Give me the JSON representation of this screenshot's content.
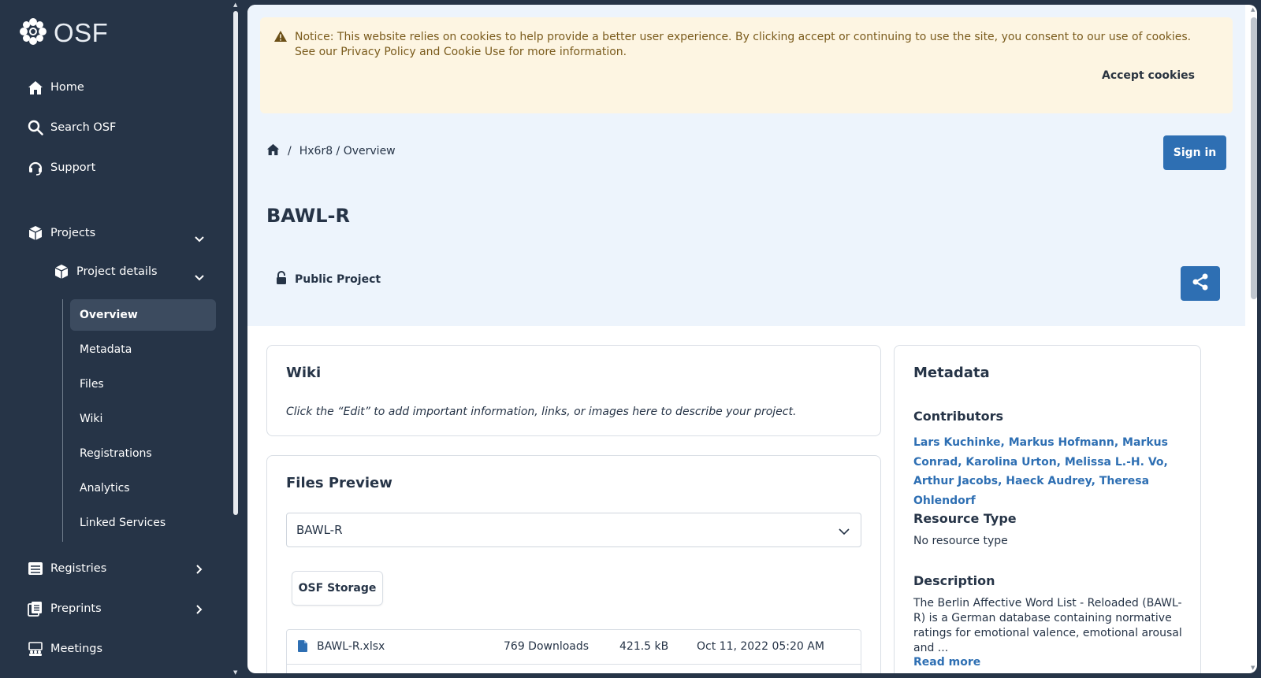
{
  "brand": {
    "name": "OSF"
  },
  "nav": {
    "home": "Home",
    "search": "Search OSF",
    "support": "Support",
    "projects": "Projects",
    "project_details": "Project details",
    "sub_items": [
      "Overview",
      "Metadata",
      "Files",
      "Wiki",
      "Registrations",
      "Analytics",
      "Linked Services"
    ],
    "registries": "Registries",
    "preprints": "Preprints",
    "meetings": "Meetings"
  },
  "cookie": {
    "message": "Notice: This website relies on cookies to help provide a better user experience. By clicking accept or continuing to use the site, you consent to our use of cookies. See our Privacy Policy and Cookie Use for more information.",
    "accept": "Accept cookies"
  },
  "breadcrumb": {
    "separator": "/",
    "path": "Hx6r8 / Overview"
  },
  "header": {
    "sign_in": "Sign in",
    "title": "BAWL-R",
    "visibility": "Public Project"
  },
  "wiki": {
    "title": "Wiki",
    "text": "Click the “Edit” to add important information, links, or images here to describe your project."
  },
  "files_preview": {
    "title": "Files Preview",
    "selected": "BAWL-R",
    "storage": "OSF Storage",
    "files": [
      {
        "name": "BAWL-R.xlsx",
        "downloads": "769 Downloads",
        "size": "421.5 kB",
        "date": "Oct 11, 2022 05:20 AM"
      }
    ]
  },
  "metadata": {
    "title": "Metadata",
    "contributors_label": "Contributors",
    "contributors": "Lars Kuchinke, Markus Hofmann, Markus Conrad, Karolina Urton, Melissa L.-H. Vo, Arthur Jacobs, Haeck Audrey, Theresa Ohlendorf",
    "resource_type_label": "Resource Type",
    "resource_type": "No resource type",
    "description_label": "Description",
    "description": "The Berlin Affective Word List - Reloaded (BAWL-R) is a German database containing normative ratings for emotional valence, emotional arousal and ...",
    "read_more": "Read more"
  },
  "colors": {
    "sidebar_bg": "#263447",
    "primary_button": "#2e6fb3",
    "link": "#2e6fb3",
    "hero_bg": "#edf4fc",
    "cookie_bg": "#fdf5e2",
    "cookie_text": "#7a5b1c"
  }
}
